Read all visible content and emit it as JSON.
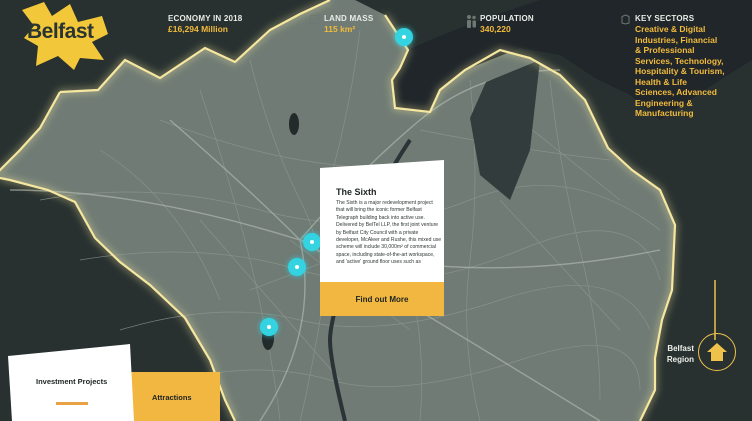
{
  "brand": {
    "name": "Belfast",
    "color": "#f2c83a"
  },
  "stats": [
    {
      "label": "ECONOMY IN 2018",
      "value": "£16,294 Million",
      "icon": ""
    },
    {
      "label": "LAND MASS",
      "value": "115 km²",
      "icon": "map-icon"
    },
    {
      "label": "POPULATION",
      "value": "340,220",
      "icon": "people-icon"
    },
    {
      "label": "KEY SECTORS",
      "value": "Creative & Digital Industries, Financial & Professional Services, Technology, Hospitality & Tourism, Health & Life Sciences, Advanced Engineering & Manufacturing",
      "icon": "sectors-icon"
    }
  ],
  "card": {
    "title": "The Sixth",
    "body": "The Sixth is a major redevelopment project that will bring the iconic former Belfast Telegraph building back into active use. Delivered by BelTel LLP, the first joint venture by Belfast City Council with a private developer, McAleer and Rushe, this mixed use scheme will include 30,000m² of commercial space, including state-of-the-art workspace, and 'active' ground floor uses such as",
    "cta": "Find out More"
  },
  "tabs": {
    "investment": "Investment Projects",
    "attractions": "Attractions"
  },
  "region": {
    "line1": "Belfast",
    "line2": "Region"
  },
  "colors": {
    "accent": "#f2b740",
    "pin": "#33d3e2",
    "boundary_glow": "#f5e7a0",
    "land": "#6f7b74",
    "water": "#22282a"
  }
}
